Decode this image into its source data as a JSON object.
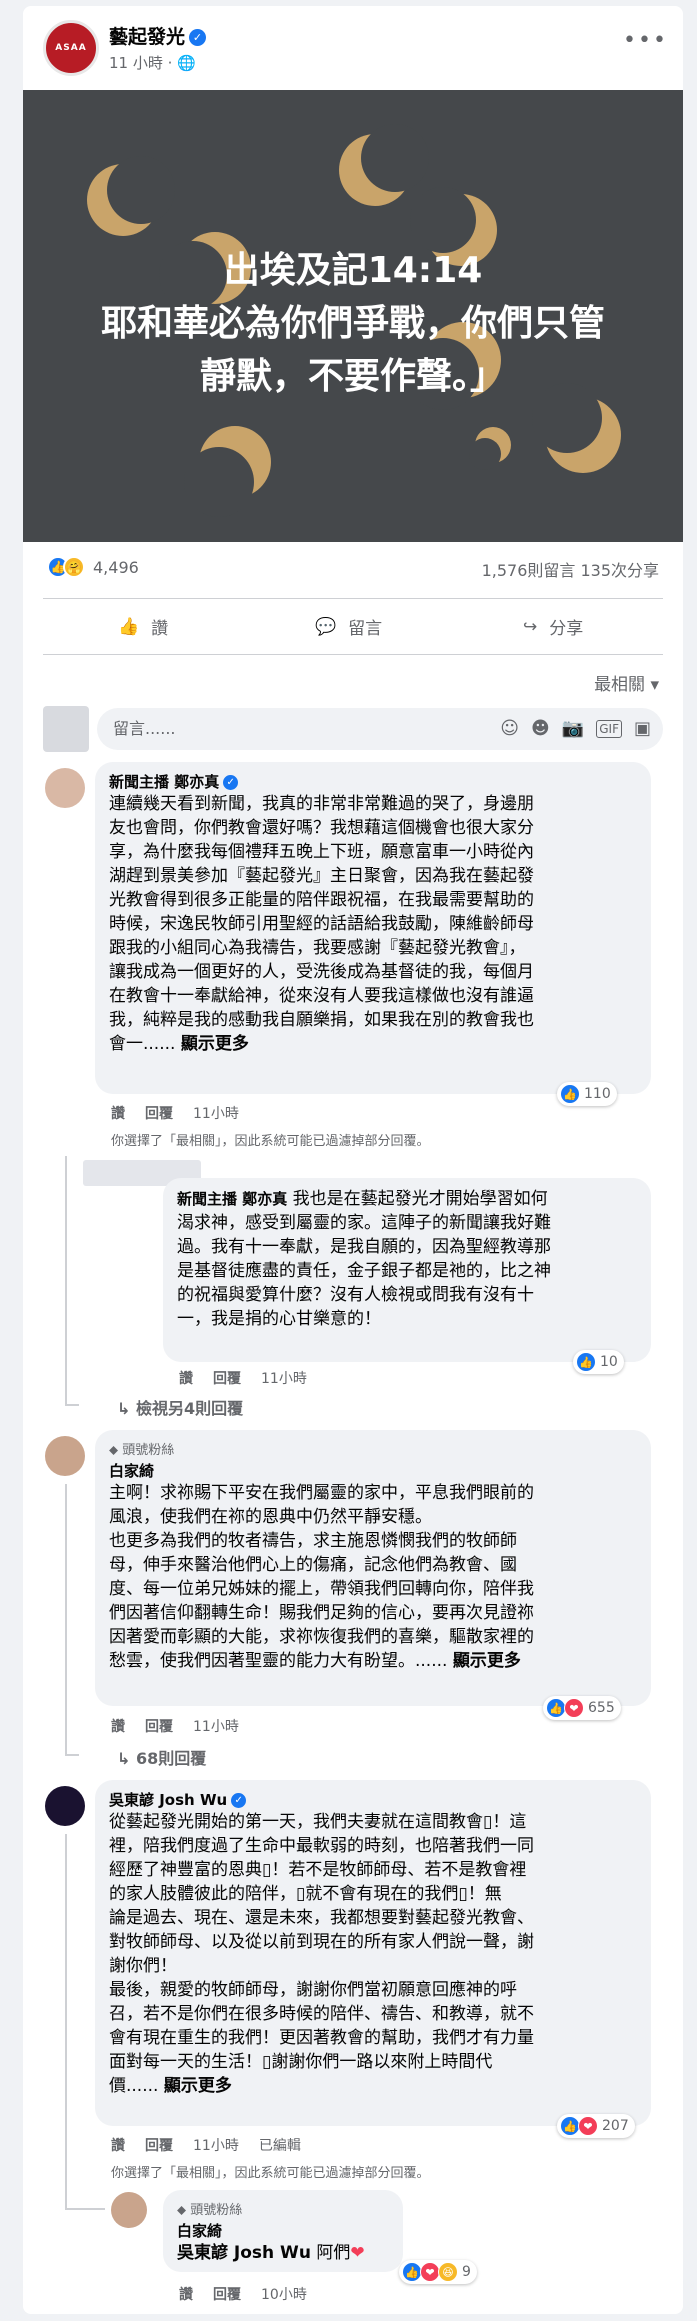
{
  "post": {
    "page_name": "藝起發光",
    "logo_text": "ASAA",
    "meta": "11 小時 · ",
    "image_text": [
      "出埃及記14:14",
      "耶和華必為你們爭戰，你們只管",
      "靜默，不要作聲。」"
    ],
    "reaction_count": "4,496",
    "counts": "1,576則留言 135次分享",
    "actions": {
      "like": "讚",
      "comment": "留言",
      "share": "分享"
    },
    "sort_label": "最相關 ▾",
    "composer_placeholder": "留言......"
  },
  "comments": [
    {
      "name": "新聞主播 鄭亦真",
      "lines": [
        "連續幾天看到新聞，我真的非常非常難過的哭了，身邊朋",
        "友也會問，你們教會還好嗎？我想藉這個機會也很大家分",
        "享，為什麼我每個禮拜五晚上下班，願意富車一小時從內",
        "湖趕到景美參加『藝起發光』主日聚會，因為我在藝起發",
        "光教會得到很多正能量的陪伴跟祝福，在我最需要幫助的",
        "時候，宋逸民牧師引用聖經的話語給我鼓勵，陳維齡師母",
        "跟我的小組同心為我禱告，我要感謝『藝起發光教會』，",
        "讓我成為一個更好的人，受洗後成為基督徒的我，每個月",
        "在教會十一奉獻給神，從來沒有人要我這樣做也沒有誰逼",
        "我，純粹是我的感動我自願樂捐，如果我在別的教會我也",
        "會一...... "
      ],
      "see_more": "顯示更多",
      "like": "讚",
      "reply": "回覆",
      "time": "11小時",
      "reactions": "110",
      "note": "你選擇了「最相關」，因此系統可能已過濾掉部分回覆。"
    },
    {
      "name": "新聞主播 鄭亦真",
      "first_line": " 我也是在藝起發光才開始學習如何",
      "lines": [
        "渴求神，感受到屬靈的家。這陣子的新聞讓我好難",
        "過。我有十一奉獻，是我自願的，因為聖經教導那",
        "是基督徒應盡的責任，金子銀子都是祂的，比之神",
        "的祝福與愛算什麼？沒有人檢視或問我有沒有十",
        "一，我是捐的心甘樂意的！"
      ],
      "like": "讚",
      "reply": "回覆",
      "time": "11小時",
      "reactions": "10"
    },
    {
      "view_replies": "↳ 檢視另4則回覆"
    },
    {
      "badge": "⬥ 頭號粉絲",
      "name": "白家綺",
      "lines": [
        "主啊！求祢賜下平安在我們屬靈的家中，平息我們眼前的",
        "風浪，使我們在祢的恩典中仍然平靜安穩。",
        "也更多為我們的牧者禱告，求主施恩憐憫我們的牧師師",
        "母，伸手來醫治他們心上的傷痛，記念他們為教會、國",
        "度、每一位弟兄姊妹的擺上，帶領我們回轉向你，陪伴我",
        "們因著信仰翻轉生命！賜我們足夠的信心，要再次見證祢",
        "因著愛而彰顯的大能，求祢恢復我們的喜樂，驅散家裡的",
        "愁雲，使我們因著聖靈的能力大有盼望。...... "
      ],
      "see_more": "顯示更多",
      "like": "讚",
      "reply": "回覆",
      "time": "11小時",
      "reactions": "655",
      "view_replies": "↳ 68則回覆"
    },
    {
      "name": "吳東諺 Josh Wu",
      "lines": [
        "從藝起發光開始的第一天，我們夫妻就在這間教會▯！這",
        "裡，陪我們度過了生命中最軟弱的時刻，也陪著我們一同",
        "經歷了神豐富的恩典▯！若不是牧師師母、若不是教會裡",
        "的家人肢體彼此的陪伴，▯就不會有現在的我們▯！無",
        "論是過去、現在、還是未來，我都想要對藝起發光教會、",
        "對牧師師母、以及從以前到現在的所有家人們說一聲，謝",
        "謝你們！",
        "最後，親愛的牧師師母，謝謝你們當初願意回應神的呼",
        "召，若不是你們在很多時候的陪伴、禱告、和教導，就不",
        "會有現在重生的我們！更因著教會的幫助，我們才有力量",
        "面對每一天的生活！▯謝謝你們一路以來附上時間代",
        "價...... "
      ],
      "see_more": "顯示更多",
      "like": "讚",
      "reply": "回覆",
      "time": "11小時",
      "edited": "已編輯",
      "reactions": "207",
      "note": "你選擇了「最相關」，因此系統可能已過濾掉部分回覆。"
    },
    {
      "badge": "⬥ 頭號粉絲",
      "name": "白家綺",
      "mention": "吳東諺 Josh Wu",
      "text": " 阿們",
      "like": "讚",
      "reply": "回覆",
      "time": "10小時",
      "reactions": "9"
    }
  ],
  "colors": {
    "accent": "#1877f2",
    "logo": "#b71c25",
    "hero_bg": "#45484b",
    "moon": "#c9a46a"
  }
}
